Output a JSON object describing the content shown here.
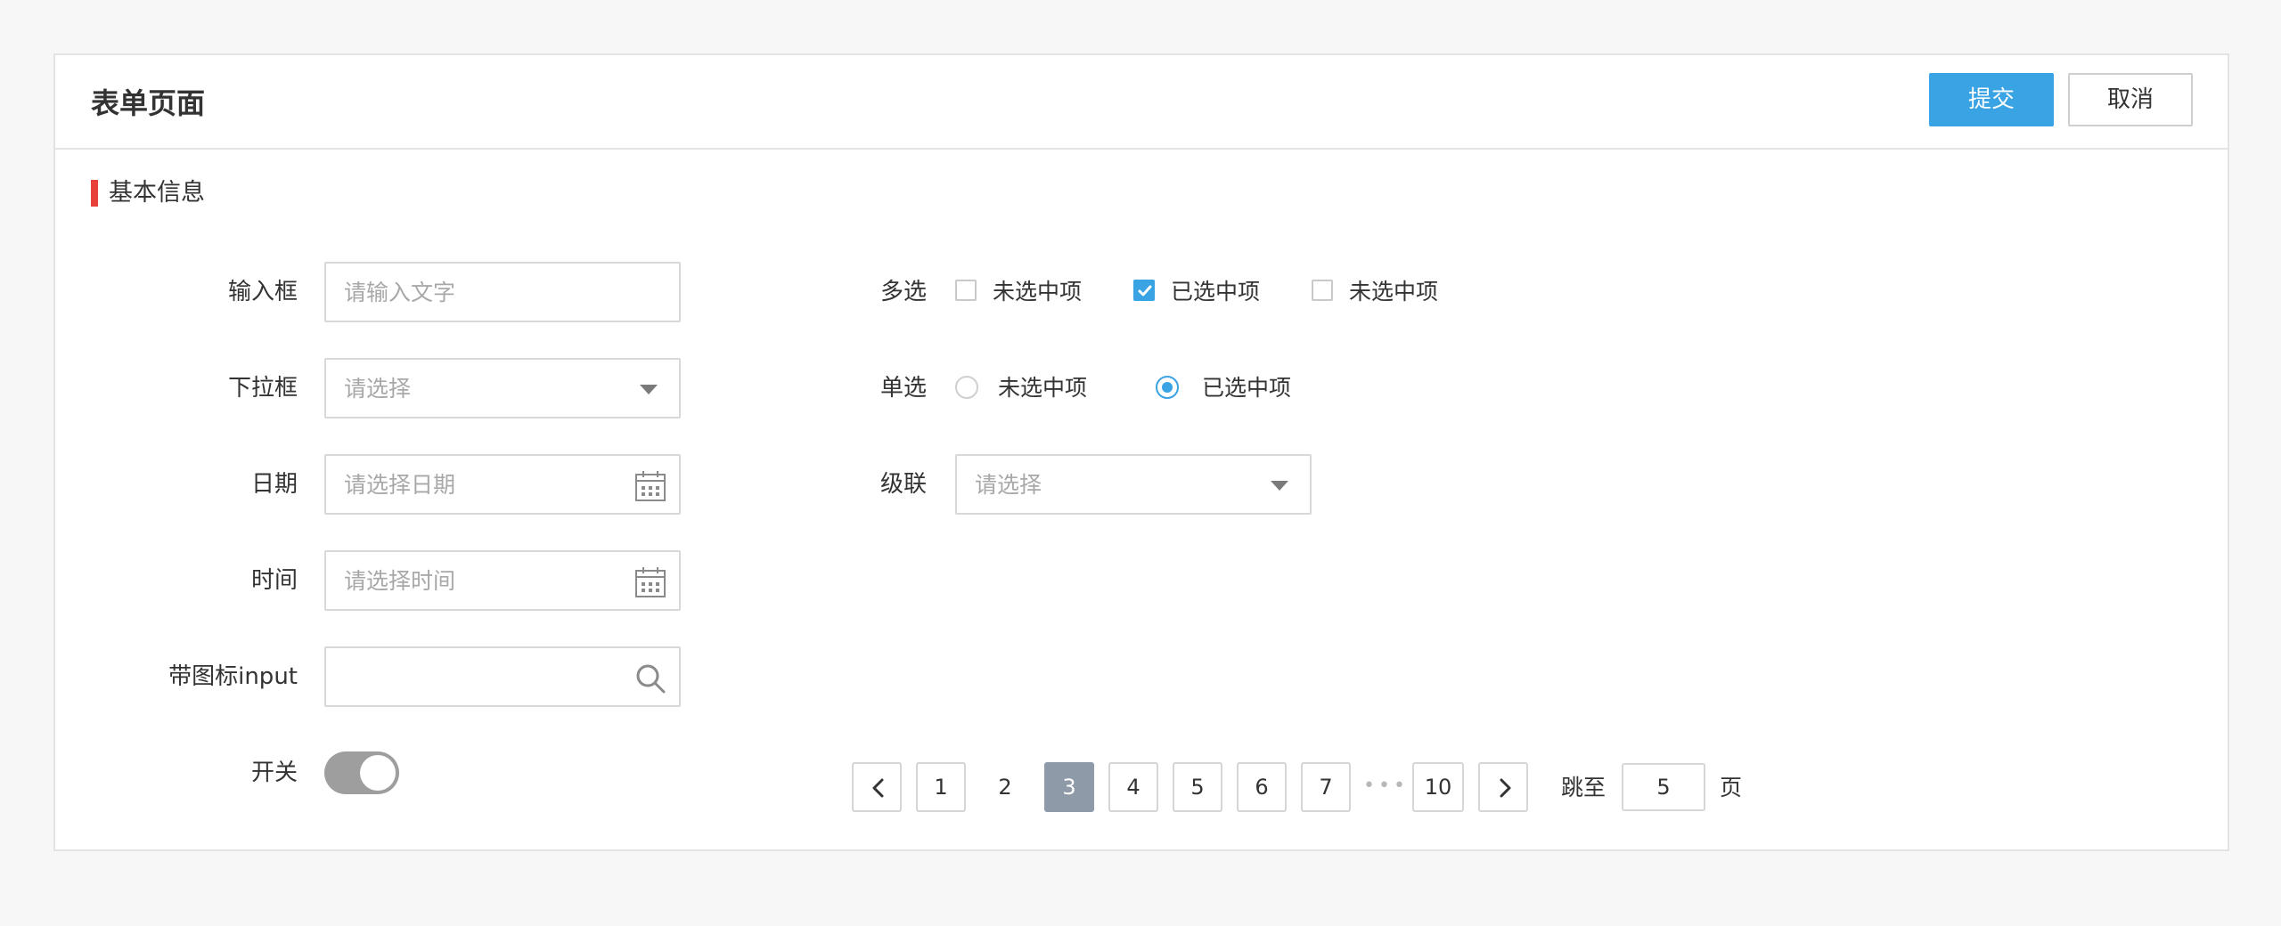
{
  "header": {
    "title": "表单页面",
    "submit_label": "提交",
    "cancel_label": "取消"
  },
  "section": {
    "title": "基本信息",
    "accent_color": "#e8413b"
  },
  "form": {
    "text_input": {
      "label": "输入框",
      "placeholder": "请输入文字",
      "value": ""
    },
    "dropdown": {
      "label": "下拉框",
      "placeholder": "请选择"
    },
    "date": {
      "label": "日期",
      "placeholder": "请选择日期",
      "icon": "calendar-icon"
    },
    "time": {
      "label": "时间",
      "placeholder": "请选择时间",
      "icon": "calendar-icon"
    },
    "icon_input": {
      "label": "带图标input",
      "value": "",
      "icon": "search-icon"
    },
    "switch": {
      "label": "开关",
      "on": true
    },
    "multi_select": {
      "label": "多选",
      "options": [
        {
          "label": "未选中项",
          "checked": false
        },
        {
          "label": "已选中项",
          "checked": true
        },
        {
          "label": "未选中项",
          "checked": false
        }
      ]
    },
    "single_select": {
      "label": "单选",
      "options": [
        {
          "label": "未选中项",
          "checked": false
        },
        {
          "label": "已选中项",
          "checked": true
        }
      ]
    },
    "cascader": {
      "label": "级联",
      "placeholder": "请选择"
    }
  },
  "pagination": {
    "pages": [
      "1",
      "2",
      "3",
      "4",
      "5",
      "6",
      "7",
      "10"
    ],
    "current": "3",
    "ellipsis": "•••",
    "jump_prefix": "跳至",
    "jump_value": "5",
    "jump_suffix": "页"
  },
  "colors": {
    "primary": "#3aa3e3",
    "active_page": "#8f9aa8",
    "switch_on": "#9e9e9e"
  }
}
